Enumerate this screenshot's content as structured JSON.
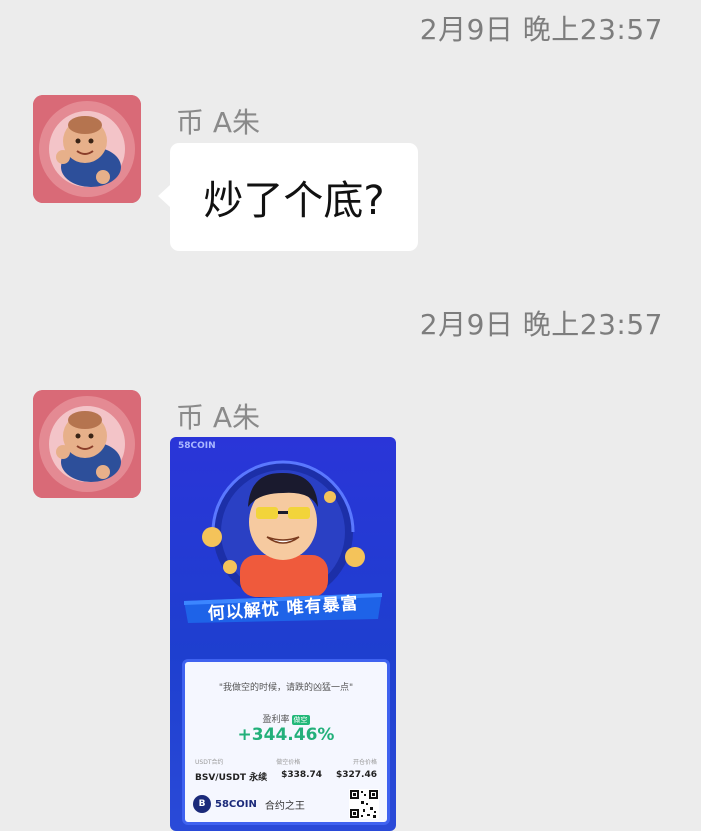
{
  "messages": [
    {
      "timestamp": "2月9日 晚上23:57",
      "sender": "币 A朱",
      "type": "text",
      "text": "炒了个底?"
    },
    {
      "timestamp": "2月9日 晚上23:57",
      "sender": "币 A朱",
      "type": "image",
      "card": {
        "brand_top": "58COIN",
        "slogan": "何以解忧 唯有暴富",
        "quote": "\"我做空的时候，请跌的凶猛一点\"",
        "rate_label": "盈利率",
        "rate_badge": "做空",
        "rate_value": "+344.46%",
        "labels": [
          "USDT合约",
          "做空价格",
          "开仓价格"
        ],
        "contract": "BSV/USDT 永续",
        "entry_price": "$338.74",
        "exit_price": "$327.46",
        "brand_name": "58COIN",
        "brand_tag": "合约之王"
      }
    }
  ],
  "colors": {
    "background": "#ececec",
    "bubble": "#ffffff",
    "card_blue": "#1e3fcf",
    "profit_green": "#22b07a"
  },
  "icons": [
    "avatar-photo",
    "brand-logo",
    "qr-code"
  ]
}
